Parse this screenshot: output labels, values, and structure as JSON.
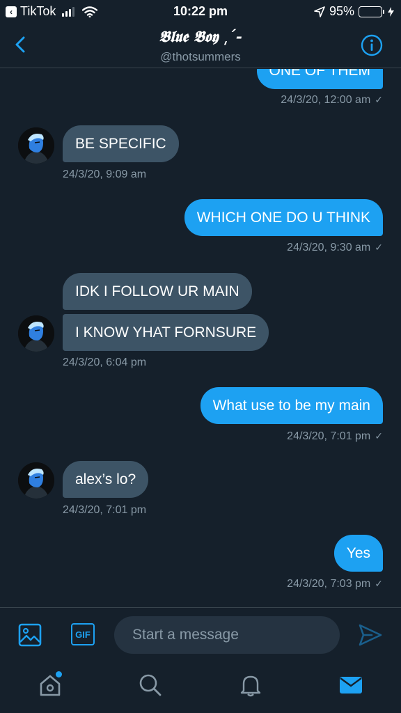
{
  "status_bar": {
    "app_back_label": "TikTok",
    "time": "10:22 pm",
    "battery_percent": "95%",
    "battery_level": 0.95,
    "signal_bars_filled": 3
  },
  "header": {
    "title": "𝕭𝖑𝖚𝖊 𝕭𝖔𝖞 ͵´-",
    "handle": "@thotsummers"
  },
  "messages": [
    {
      "direction": "out",
      "text": "ONE OF THEM",
      "timestamp": "24/3/20, 12:00 am",
      "read_mark": "✓"
    },
    {
      "direction": "in",
      "text": "BE SPECIFIC",
      "timestamp": "24/3/20, 9:09 am"
    },
    {
      "direction": "out",
      "text": "WHICH ONE DO U THINK",
      "timestamp": "24/3/20, 9:30 am",
      "read_mark": "✓"
    },
    {
      "direction": "in",
      "text": "IDK I FOLLOW UR MAIN"
    },
    {
      "direction": "in",
      "text": "I KNOW YHAT FORNSURE",
      "timestamp": "24/3/20, 6:04 pm"
    },
    {
      "direction": "out",
      "text": "What use to be my main",
      "timestamp": "24/3/20, 7:01 pm",
      "read_mark": "✓"
    },
    {
      "direction": "in",
      "text": "alex’s lo?",
      "timestamp": "24/3/20, 7:01 pm"
    },
    {
      "direction": "out",
      "text": "Yes",
      "timestamp": "24/3/20, 7:03 pm",
      "read_mark": "✓"
    }
  ],
  "composer": {
    "placeholder": "Start a message",
    "gif_label": "GIF"
  },
  "tabs": [
    {
      "name": "home",
      "icon": "home-icon",
      "has_notification_dot": true
    },
    {
      "name": "search",
      "icon": "search-icon"
    },
    {
      "name": "notifications",
      "icon": "bell-icon"
    },
    {
      "name": "messages",
      "icon": "mail-icon",
      "active": true
    }
  ],
  "colors": {
    "background": "#15202b",
    "accent": "#1da1f2",
    "incoming_bubble": "#3d5466",
    "secondary_text": "#8899a6",
    "battery_green": "#4cd964"
  }
}
